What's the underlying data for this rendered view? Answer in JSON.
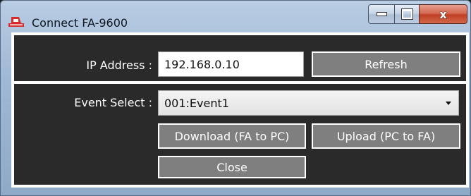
{
  "window": {
    "title": "Connect FA-9600",
    "controls": {
      "minimize": "minimize",
      "maximize": "maximize",
      "close": "x"
    }
  },
  "connection": {
    "ip_label": "IP Address :",
    "ip_value": "192.168.0.10",
    "refresh_label": "Refresh"
  },
  "event": {
    "label": "Event Select :",
    "selected": "001:Event1"
  },
  "actions": {
    "download_label": "Download (FA to PC)",
    "upload_label": "Upload (PC to FA)",
    "close_label": "Close"
  },
  "icons": {
    "app": "fa-device-icon",
    "dropdown": "chevron-down-icon"
  },
  "colors": {
    "panel_bg": "#2a2a2a",
    "button_bg": "#7f7f7f",
    "button_border": "#ffffff",
    "app_icon": "#d62b2b",
    "close_button": "#c94a30"
  }
}
